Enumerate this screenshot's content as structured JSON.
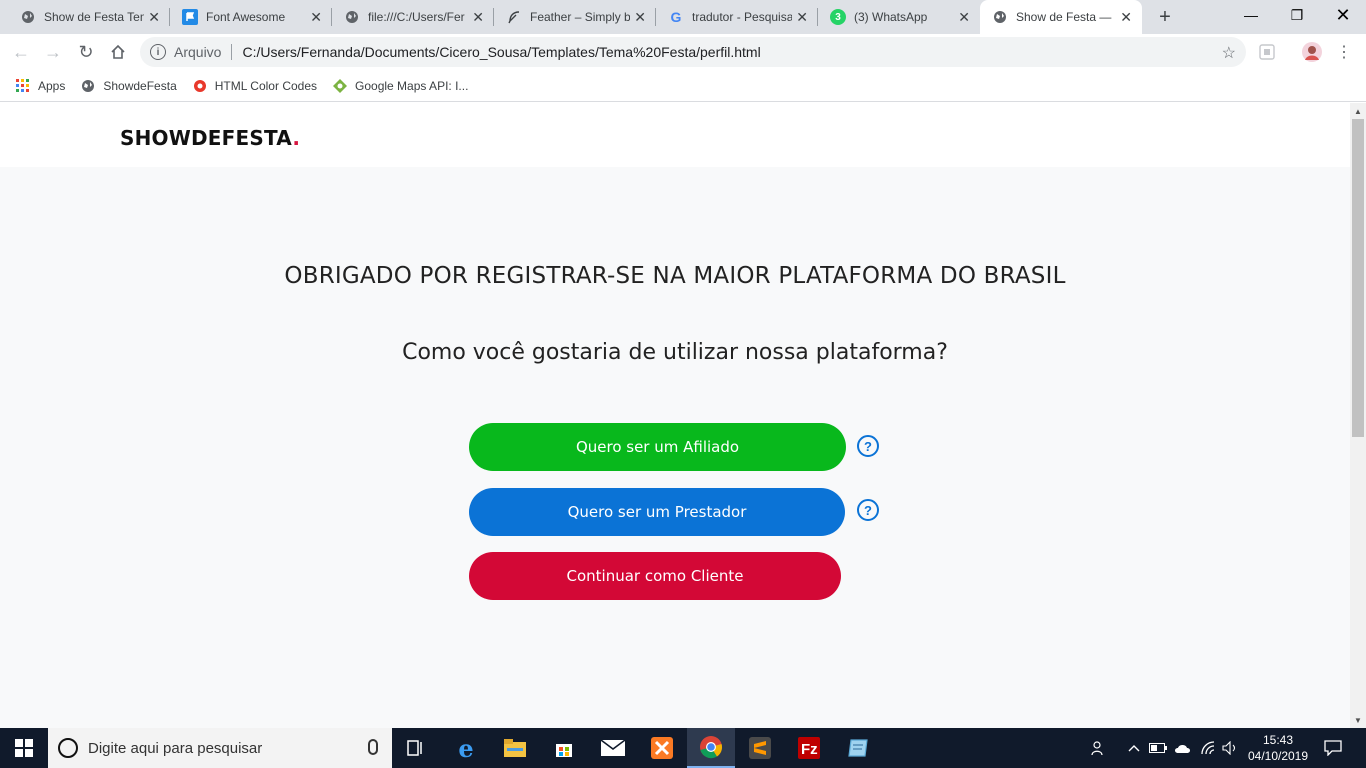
{
  "browser": {
    "tabs": [
      {
        "title": "Show de Festa Tem",
        "icon": "globe-icon"
      },
      {
        "title": "Font Awesome",
        "icon": "flag-icon"
      },
      {
        "title": "file:///C:/Users/Fer",
        "icon": "globe-icon"
      },
      {
        "title": "Feather – Simply b",
        "icon": "feather-icon"
      },
      {
        "title": "tradutor - Pesquisa",
        "icon": "google-icon"
      },
      {
        "title": "(3) WhatsApp",
        "icon": "whatsapp-icon",
        "badge": "3"
      },
      {
        "title": "Show de Festa — ",
        "icon": "globe-icon",
        "active": true
      }
    ],
    "address": {
      "scheme_label": "Arquivo",
      "url": "C:/Users/Fernanda/Documents/Cicero_Sousa/Templates/Tema%20Festa/perfil.html"
    },
    "bookmarks": [
      {
        "label": "Apps",
        "icon": "apps-grid-icon"
      },
      {
        "label": "ShowdeFesta",
        "icon": "globe-icon"
      },
      {
        "label": "HTML Color Codes",
        "icon": "color-codes-icon"
      },
      {
        "label": "Google Maps API: I...",
        "icon": "maps-icon"
      }
    ]
  },
  "page": {
    "brand": "SHOWDEFESTA",
    "brand_dot": ".",
    "headline": "OBRIGADO POR REGISTRAR-SE NA MAIOR PLATAFORMA DO BRASIL",
    "question": "Como você gostaria de utilizar nossa plataforma?",
    "buttons": {
      "affiliate": "Quero ser um Afiliado",
      "provider": "Quero ser um Prestador",
      "client": "Continuar como Cliente"
    },
    "help_glyph": "?",
    "colors": {
      "affiliate": "#08b81c",
      "provider": "#0b73d6",
      "client": "#d30836",
      "brand_dot": "#d6153f"
    }
  },
  "taskbar": {
    "search_placeholder": "Digite aqui para pesquisar",
    "time": "15:43",
    "date": "04/10/2019"
  }
}
